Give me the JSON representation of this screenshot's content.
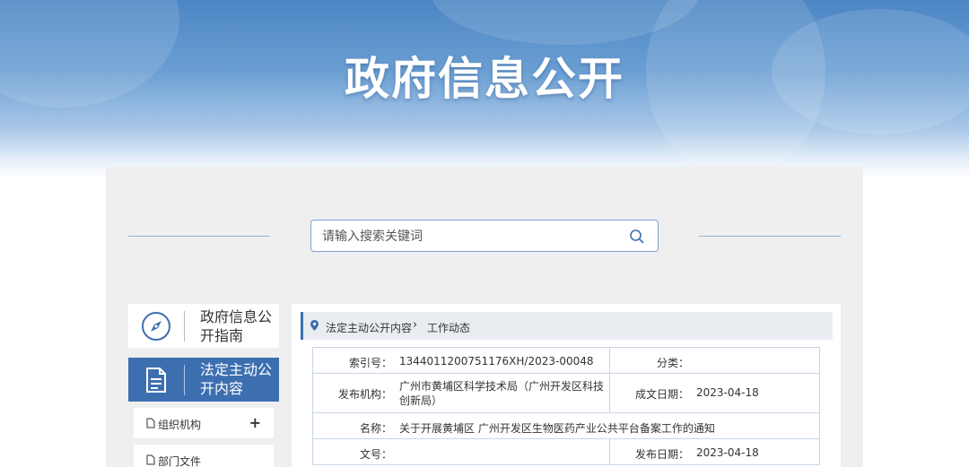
{
  "header": {
    "title": "政府信息公开"
  },
  "search": {
    "placeholder": "请输入搜索关键词"
  },
  "sidebar": {
    "guide_label": "政府信息公开指南",
    "active_label": "法定主动公开内容",
    "items": [
      {
        "label": "组织机构",
        "expander": "+"
      },
      {
        "label": "部门文件"
      }
    ]
  },
  "breadcrumb": {
    "level1": "法定主动公开内容",
    "separator": "›",
    "level2": "工作动态"
  },
  "meta": {
    "index_label": "索引号：",
    "index_value": "1344011200751176XH/2023-00048",
    "category_label": "分类：",
    "category_value": "",
    "org_label": "发布机构：",
    "org_value": "广州市黄埔区科学技术局（广州开发区科技创新局）",
    "created_label": "成文日期：",
    "created_value": "2023-04-18",
    "name_label": "名称：",
    "name_value": "关于开展黄埔区 广州开发区生物医药产业公共平台备案工作的通知",
    "docno_label": "文号：",
    "docno_value": "",
    "published_label": "发布日期：",
    "published_value": "2023-04-18"
  },
  "colors": {
    "accent": "#3d6fb0",
    "banner": "#4c86c4"
  },
  "icons": {
    "guide": "compass-icon",
    "active": "document-icon",
    "search": "search-icon",
    "breadcrumb": "location-pin-icon"
  }
}
